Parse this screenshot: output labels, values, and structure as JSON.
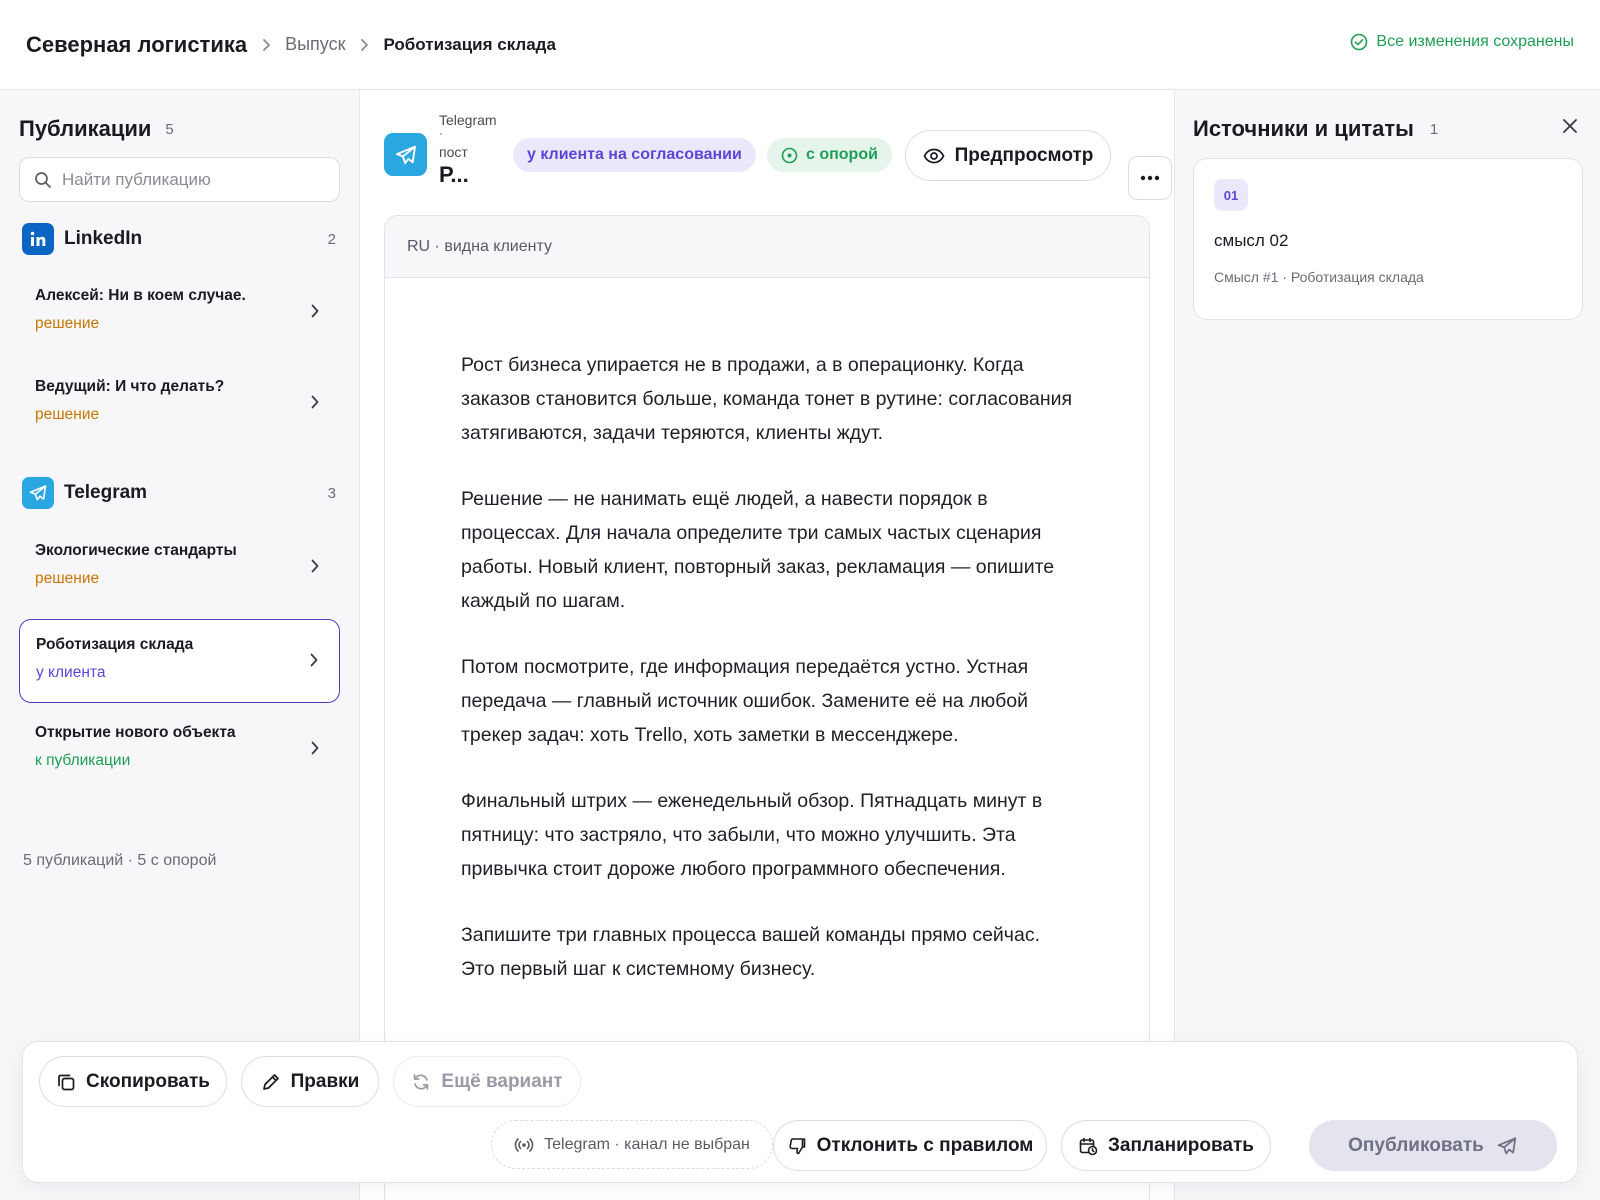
{
  "header": {
    "org": "Северная логистика",
    "section": "Выпуск",
    "current": "Роботизация склада",
    "saved_status": "Все изменения сохранены"
  },
  "sidebar": {
    "title": "Публикации",
    "count": "5",
    "search_placeholder": "Найти публикацию",
    "groups": [
      {
        "name": "LinkedIn",
        "count": "2",
        "icon": "linkedin-icon",
        "items": [
          {
            "title": "Алексей: Ни в коем случае.",
            "status": "решение"
          },
          {
            "title": "Ведущий: И что делать?",
            "status": "решение"
          }
        ]
      },
      {
        "name": "Telegram",
        "count": "3",
        "icon": "telegram-icon",
        "items": [
          {
            "title": "Экологические стандарты",
            "status": "решение"
          },
          {
            "title": "Роботизация склада",
            "status": "у клиента"
          },
          {
            "title": "Открытие нового объекта",
            "status": "к публикации"
          }
        ]
      }
    ],
    "footer": "5 публикаций · 5 с опорой"
  },
  "post": {
    "channel": "Telegram",
    "dot": "·",
    "kind": "пост",
    "title_short": "Р...",
    "status_pill": "у клиента на согласовании",
    "support_pill": "с опорой",
    "preview_label": "Предпросмотр",
    "doc_meta": "RU · видна клиенту",
    "paragraphs": [
      "Рост бизнеса упирается не в продажи, а в операционку. Когда заказов становится больше, команда тонет в рутине: согласования затягиваются, задачи теряются, клиенты ждут.",
      "Решение — не нанимать ещё людей, а навести порядок в процессах. Для начала определите три самых частых сценария работы. Новый клиент, повторный заказ, рекламация — опишите каждый по шагам.",
      "Потом посмотрите, где информация передаётся устно. Устная передача — главный источник ошибок. Замените её на любой трекер задач: хоть Trello, хоть заметки в мессенджере.",
      "Финальный штрих — еженедельный обзор. Пятнадцать минут в пятницу: что застряло, что забыли, что можно улучшить. Эта привычка стоит дороже любого программного обеспечения.",
      "Запишите три главных процесса вашей команды прямо сейчас. Это первый шаг к системному бизнесу."
    ]
  },
  "sources": {
    "title": "Источники и цитаты",
    "count": "1",
    "items": [
      {
        "num": "01",
        "text": "смысл 02",
        "source": "Смысл #1 · Роботизация склада"
      }
    ]
  },
  "actions": {
    "copy": "Скопировать",
    "edits": "Правки",
    "another": "Ещё вариант",
    "channel": "Telegram · канал не выбран",
    "reject": "Отклонить с правилом",
    "schedule": "Запланировать",
    "publish": "Опубликовать"
  },
  "colors": {
    "accent_purple": "#5b46d6",
    "status_orange": "#c77700",
    "status_green": "#1f9d55",
    "telegram": "#2aa6e0",
    "linkedin": "#0a66c2"
  }
}
